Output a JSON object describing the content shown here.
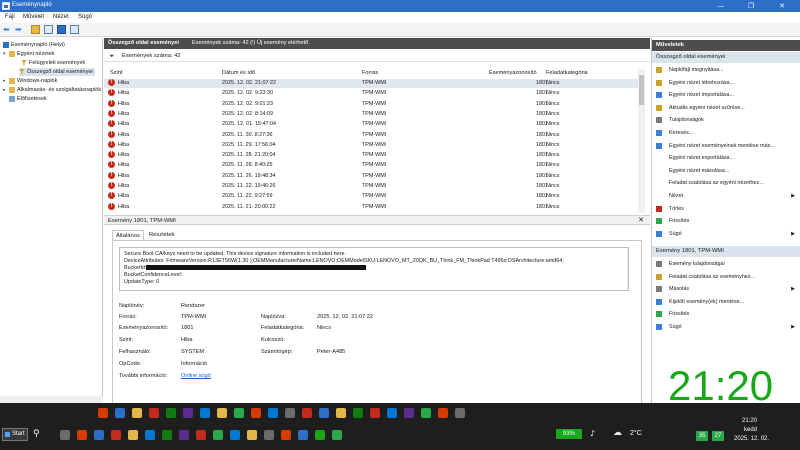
{
  "window": {
    "title": "Eseménynapló",
    "buttons": {
      "minimize": "—",
      "maximize": "❐",
      "close": "✕"
    }
  },
  "menu": [
    "Fájl",
    "Művelet",
    "Nézet",
    "Súgó"
  ],
  "tree": {
    "root": "Eseménynapló (Helyi)",
    "custom_views": "Egyéni nézetek",
    "admin_events": "Felügyeleti események",
    "summary_page": "Összegző oldal eseményei",
    "windows_logs": "Windows-naplók",
    "apps_services": "Alkalmazás- és szolgáltatásnaplók",
    "subscriptions": "Előfizetések"
  },
  "center": {
    "header_title": "Összegző oldal eseményei",
    "header_info": "Események száma: 42 (!) Új esemény elérhető",
    "filter_text": "Események száma: 42",
    "columns": [
      "Szint",
      "Dátum és idő",
      "Forrás",
      "Eseményazonosító",
      "Feladatkategória"
    ],
    "rows": [
      {
        "level": "Hiba",
        "datetime": "2025. 12. 02. 21:07:22",
        "source": "TPM-WMI",
        "id": "1801",
        "task": "Nincs"
      },
      {
        "level": "Hiba",
        "datetime": "2025. 12. 02. 9:23:30",
        "source": "TPM-WMI",
        "id": "1801",
        "task": "Nincs"
      },
      {
        "level": "Hiba",
        "datetime": "2025. 12. 02. 9:01:23",
        "source": "TPM-WMI",
        "id": "1801",
        "task": "Nincs"
      },
      {
        "level": "Hiba",
        "datetime": "2025. 12. 02. 8:14:09",
        "source": "TPM-WMI",
        "id": "1801",
        "task": "Nincs"
      },
      {
        "level": "Hiba",
        "datetime": "2025. 12. 01. 15:47:04",
        "source": "TPM-WMI",
        "id": "1801",
        "task": "Nincs"
      },
      {
        "level": "Hiba",
        "datetime": "2025. 11. 30. 8:27:36",
        "source": "TPM-WMI",
        "id": "1801",
        "task": "Nincs"
      },
      {
        "level": "Hiba",
        "datetime": "2025. 11. 29. 17:56:04",
        "source": "TPM-WMI",
        "id": "1801",
        "task": "Nincs"
      },
      {
        "level": "Hiba",
        "datetime": "2025. 11. 28. 21:20:04",
        "source": "TPM-WMI",
        "id": "1801",
        "task": "Nincs"
      },
      {
        "level": "Hiba",
        "datetime": "2025. 11. 28. 8:40:25",
        "source": "TPM-WMI",
        "id": "1801",
        "task": "Nincs"
      },
      {
        "level": "Hiba",
        "datetime": "2025. 11. 26. 19:48:34",
        "source": "TPM-WMI",
        "id": "1801",
        "task": "Nincs"
      },
      {
        "level": "Hiba",
        "datetime": "2025. 11. 22. 19:46:26",
        "source": "TPM-WMI",
        "id": "1801",
        "task": "Nincs"
      },
      {
        "level": "Hiba",
        "datetime": "2025. 11. 22. 9:27:59",
        "source": "TPM-WMI",
        "id": "1801",
        "task": "Nincs"
      },
      {
        "level": "Hiba",
        "datetime": "2025. 11. 21. 20:00:22",
        "source": "TPM-WMI",
        "id": "1801",
        "task": "Nincs"
      }
    ]
  },
  "detail": {
    "header": "Esemény 1801, TPM-WMI",
    "close": "✕",
    "tabs": [
      "Általános",
      "Részletek"
    ],
    "description_lines": [
      "Secure Boot CA/keys need to be updated. This device signature information is included here.",
      "DeviceAttributes: FirmwareVersion:R13ET56W(1.30 );OEMManufacturerName:LENOVO;OEMModelSKU:LENOVO_MT_20QK_BU_Think_FM_ThinkPad T495s;OSArchitecture:amd64;",
      "BucketId:",
      "BucketConfidenceLevel:",
      "UpdateType: 0"
    ],
    "fields": {
      "log_name_label": "Naplónév:",
      "log_name": "Rendszer",
      "source_label": "Forrás:",
      "source": "TPM-WMI",
      "logged_label": "Naplózva:",
      "logged": "2025. 12. 02. 21:07:22",
      "event_id_label": "Eseményazonosító:",
      "event_id": "1801",
      "task_label": "Feladatkategória:",
      "task": "Nincs",
      "level_label": "Szint:",
      "level": "Hiba",
      "keywords_label": "Kulcsszó:",
      "keywords": "",
      "user_label": "Felhasználó:",
      "user": "SYSTEM",
      "computer_label": "Számítógép:",
      "computer": "Peter-A485",
      "opcode_label": "OpCode:",
      "opcode": "Információ",
      "more_info_label": "További információ:",
      "more_info_link": "Online súgó"
    }
  },
  "actions": {
    "title": "Műveletek",
    "section1": "Összegző oldal eseményei",
    "items1": [
      {
        "label": "Naplófájl megnyitása...",
        "icon": "open-log-icon",
        "color": "#c9a227"
      },
      {
        "label": "Egyéni nézet létrehozása...",
        "icon": "filter-create-icon",
        "color": "#c9a227"
      },
      {
        "label": "Egyéni nézet importálása...",
        "icon": "import-icon",
        "color": "#3b7dd8"
      },
      {
        "label": "Aktuális egyéni nézet szűrése...",
        "icon": "filter-icon",
        "color": "#c9a227"
      },
      {
        "label": "Tulajdonságok",
        "icon": "properties-icon",
        "color": "#7a7a7a"
      },
      {
        "label": "Keresés...",
        "icon": "search-icon",
        "color": "#3b7dd8"
      },
      {
        "label": "Egyéni nézet eseményeinek mentése más...",
        "icon": "save-icon",
        "color": "#3b7dd8"
      },
      {
        "label": "Egyéni nézet exportálása...",
        "icon": "",
        "color": ""
      },
      {
        "label": "Egyéni nézet másolása...",
        "icon": "",
        "color": ""
      },
      {
        "label": "Feladat csatolása az egyéni nézethez...",
        "icon": "",
        "color": ""
      },
      {
        "label": "Nézet",
        "icon": "",
        "color": "",
        "arrow": "▶"
      },
      {
        "label": "Törlés",
        "icon": "delete-icon",
        "color": "#c42b1c"
      },
      {
        "label": "Frissítés",
        "icon": "refresh-icon",
        "color": "#2aa84a"
      },
      {
        "label": "Súgó",
        "icon": "help-icon",
        "color": "#3b7dd8",
        "arrow": "▶"
      }
    ],
    "section2": "Esemény 1801, TPM-WMI",
    "items2": [
      {
        "label": "Esemény tulajdonságai",
        "icon": "event-props-icon",
        "color": "#7a7a7a"
      },
      {
        "label": "Feladat csatolása az eseményhez...",
        "icon": "attach-task-icon",
        "color": "#c9a227"
      },
      {
        "label": "Másolás",
        "icon": "copy-icon",
        "color": "#7a7a7a",
        "arrow": "▶"
      },
      {
        "label": "Kijelölt esemény(ek) mentése...",
        "icon": "save-icon",
        "color": "#3b7dd8"
      },
      {
        "label": "Frissítés",
        "icon": "refresh-icon",
        "color": "#2aa84a"
      },
      {
        "label": "Súgó",
        "icon": "help-icon",
        "color": "#3b7dd8",
        "arrow": "▶"
      }
    ]
  },
  "overlay_clock": "21:20",
  "taskbar": {
    "start": "Start",
    "battery": "93%",
    "temperature": "2°C",
    "tray_time": "21:20",
    "tray_day": "kedd",
    "tray_date": "2025. 12. 02.",
    "tray_badges": [
      "35",
      "27"
    ]
  },
  "colors": {
    "accent": "#2b6fc9",
    "error": "#c42b1c",
    "clock": "#1aa81a",
    "header_dark": "#4d4d4d"
  }
}
